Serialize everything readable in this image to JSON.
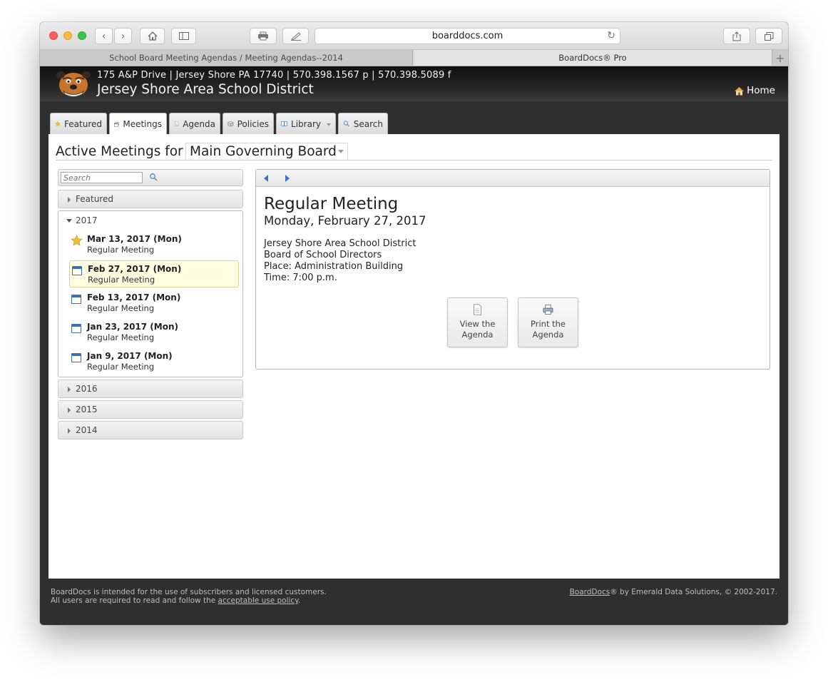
{
  "browser": {
    "url": "boarddocs.com",
    "tabs": [
      {
        "label": "School Board Meeting Agendas / Meeting Agendas--2014"
      },
      {
        "label": "BoardDocs® Pro"
      }
    ],
    "new_tab": "+"
  },
  "header": {
    "address": "175 A&P Drive | Jersey Shore PA 17740 | 570.398.1567 p | 570.398.5089 f",
    "district": "Jersey Shore Area School District",
    "home": "Home"
  },
  "app_tabs": [
    {
      "label": "Featured",
      "icon": "star-icon"
    },
    {
      "label": "Meetings",
      "icon": "meetings-icon"
    },
    {
      "label": "Agenda",
      "icon": "document-icon"
    },
    {
      "label": "Policies",
      "icon": "box-icon"
    },
    {
      "label": "Library",
      "icon": "book-icon"
    },
    {
      "label": "Search",
      "icon": "search-icon"
    }
  ],
  "active_meetings": {
    "label": "Active Meetings for",
    "board": "Main Governing Board"
  },
  "sidebar": {
    "search_placeholder": "Search",
    "featured": "Featured",
    "year_open": "2017",
    "meetings": [
      {
        "date": "Mar 13, 2017 (Mon)",
        "name": "Regular Meeting",
        "icon": "star-icon"
      },
      {
        "date": "Feb 27, 2017 (Mon)",
        "name": "Regular Meeting",
        "icon": "calendar-icon"
      },
      {
        "date": "Feb 13, 2017 (Mon)",
        "name": "Regular Meeting",
        "icon": "calendar-icon"
      },
      {
        "date": "Jan 23, 2017 (Mon)",
        "name": "Regular Meeting",
        "icon": "calendar-icon"
      },
      {
        "date": "Jan 9, 2017 (Mon)",
        "name": "Regular Meeting",
        "icon": "calendar-icon"
      }
    ],
    "years_closed": [
      "2016",
      "2015",
      "2014"
    ]
  },
  "detail": {
    "title": "Regular Meeting",
    "date": "Monday, February 27, 2017",
    "lines": [
      "Jersey Shore Area School District",
      "Board of School Directors",
      "Place: Administration Building",
      "Time: 7:00 p.m."
    ],
    "view_button": {
      "line1": "View the",
      "line2": "Agenda"
    },
    "print_button": {
      "line1": "Print the",
      "line2": "Agenda"
    }
  },
  "footer": {
    "left_line1": "BoardDocs is intended for the use of subscribers and licensed customers.",
    "left_line2_prefix": "All users are required to read and follow the ",
    "left_link": "acceptable use policy",
    "left_line2_suffix": ".",
    "right_link": "BoardDocs",
    "right_suffix": "® by Emerald Data Solutions, © 2002-2017."
  },
  "colors": {
    "accent_blue": "#3a73c9",
    "selected_bg": "#fffde0",
    "header_bg": "#1a1a1a",
    "frame_bg": "#2f2f2f"
  }
}
